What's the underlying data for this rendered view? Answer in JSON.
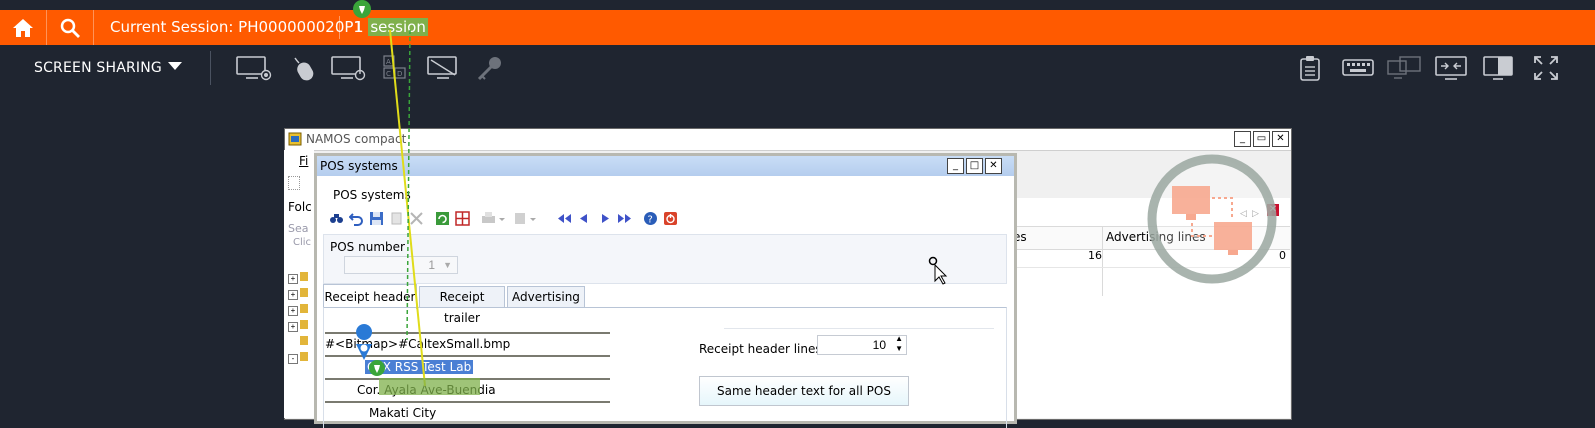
{
  "topbar": {
    "session_title": "Current Session: PH000000020P1",
    "session_count": "1",
    "session_word": "session"
  },
  "toolbar": {
    "screen_sharing": "SCREEN SHARING",
    "left_icons": [
      "monitor-record-icon",
      "mouse-icon",
      "monitor-power-icon",
      "keyboard-keys-icon",
      "monitor-off-icon",
      "key-icon"
    ],
    "right_icons": [
      "clipboard-icon",
      "keyboard-icon",
      "multi-monitor-icon",
      "fit-screen-icon",
      "single-monitor-icon",
      "fullscreen-icon"
    ]
  },
  "namos": {
    "title": "NAMOS compact",
    "menu_hint": "Fi",
    "tab_fold": "Folc",
    "search": "Sea",
    "click": "Clic"
  },
  "pos": {
    "title": "POS systems",
    "menu_label": "POS systems",
    "pos_number_label": "POS number",
    "pos_number_value": "1",
    "tabs": [
      "Receipt header",
      "Receipt trailer",
      "Advertising"
    ],
    "header_lines": [
      "#<Bitmap>#CaltexSmall.bmp",
      "CTX RSS Test Lab",
      "Cor. Ayala Ave-Buendia",
      "Makati City"
    ],
    "receipt_header_lines_label": "Receipt header lines",
    "receipt_header_lines_value": "10",
    "same_header_button": "Same header text for all POS"
  },
  "right_panel": {
    "col_es": "es",
    "col_advertising": "Advertising lines",
    "val_16": "16",
    "val_0": "0"
  }
}
